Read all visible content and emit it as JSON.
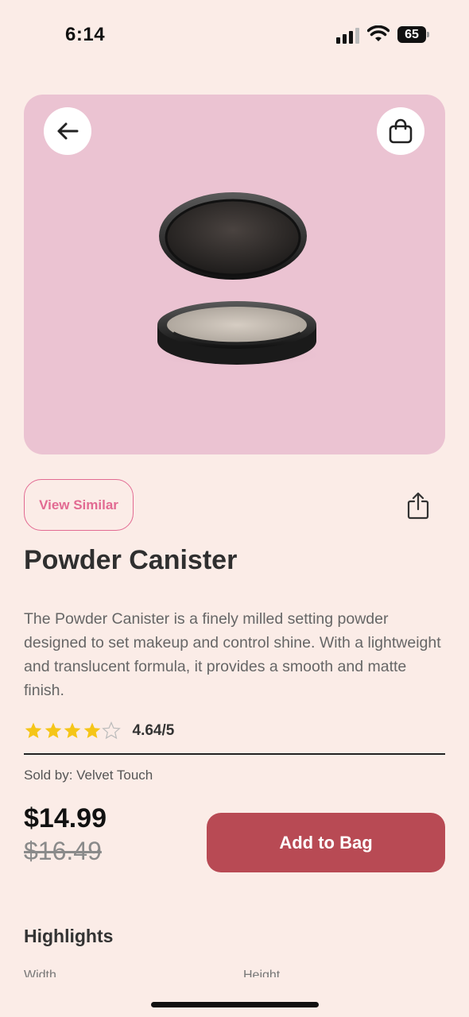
{
  "status": {
    "time": "6:14",
    "battery": "65"
  },
  "product": {
    "title": "Powder Canister",
    "description": "The Powder Canister is a finely milled setting powder designed to set makeup and control shine. With a lightweight and translucent formula, it provides a smooth and matte finish.",
    "rating_text": "4.64/5",
    "rating_value": 4.64,
    "rating_max": 5,
    "sold_by": "Sold by: Velvet Touch",
    "price": "$14.99",
    "old_price": "$16.49"
  },
  "actions": {
    "view_similar": "View Similar",
    "add_to_bag": "Add to Bag"
  },
  "highlights": {
    "title": "Highlights",
    "width_label": "Width",
    "height_label": "Height"
  },
  "icons": {
    "back": "arrow-left-icon",
    "bag": "shopping-bag-icon",
    "share": "share-icon",
    "star": "star-icon"
  },
  "colors": {
    "background": "#fbece7",
    "hero": "#ebc3d2",
    "accent_pink": "#e26a92",
    "button": "#b84a54",
    "star": "#f5c518"
  }
}
